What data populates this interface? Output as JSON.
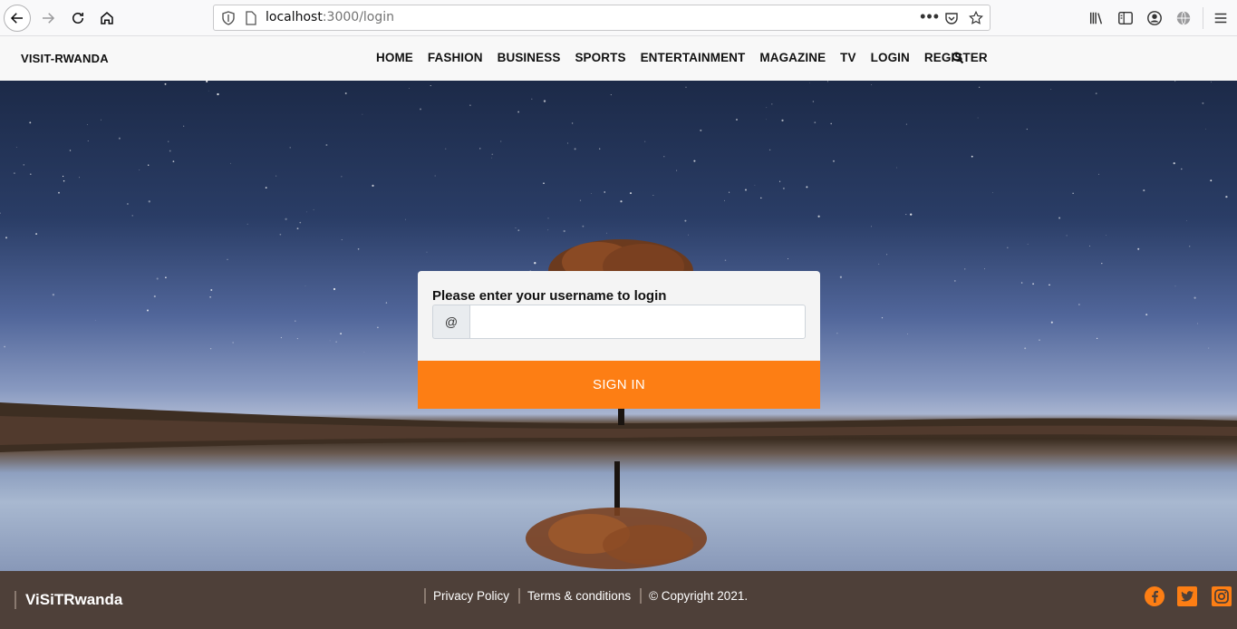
{
  "browser": {
    "url_host": "localhost",
    "url_path": ":3000/login",
    "dots": "•••"
  },
  "site": {
    "brand": "VISIT-RWANDA",
    "nav": [
      "HOME",
      "FASHION",
      "BUSINESS",
      "SPORTS",
      "ENTERTAINMENT",
      "MAGAZINE",
      "TV",
      "LOGIN",
      "REGISTER"
    ]
  },
  "login": {
    "prompt": "Please enter your username to login",
    "addon": "@",
    "username_value": "",
    "button": "SIGN IN"
  },
  "footer": {
    "brand": "ViSiTRwanda",
    "links": [
      "Privacy Policy",
      "Terms & conditions",
      "© Copyright 2021."
    ]
  },
  "colors": {
    "accent": "#fd7e14",
    "footer_bg": "#4e4039",
    "nav_bg": "#f8f8f8"
  },
  "icons": {
    "social": [
      "facebook-icon",
      "twitter-icon",
      "instagram-icon"
    ]
  }
}
